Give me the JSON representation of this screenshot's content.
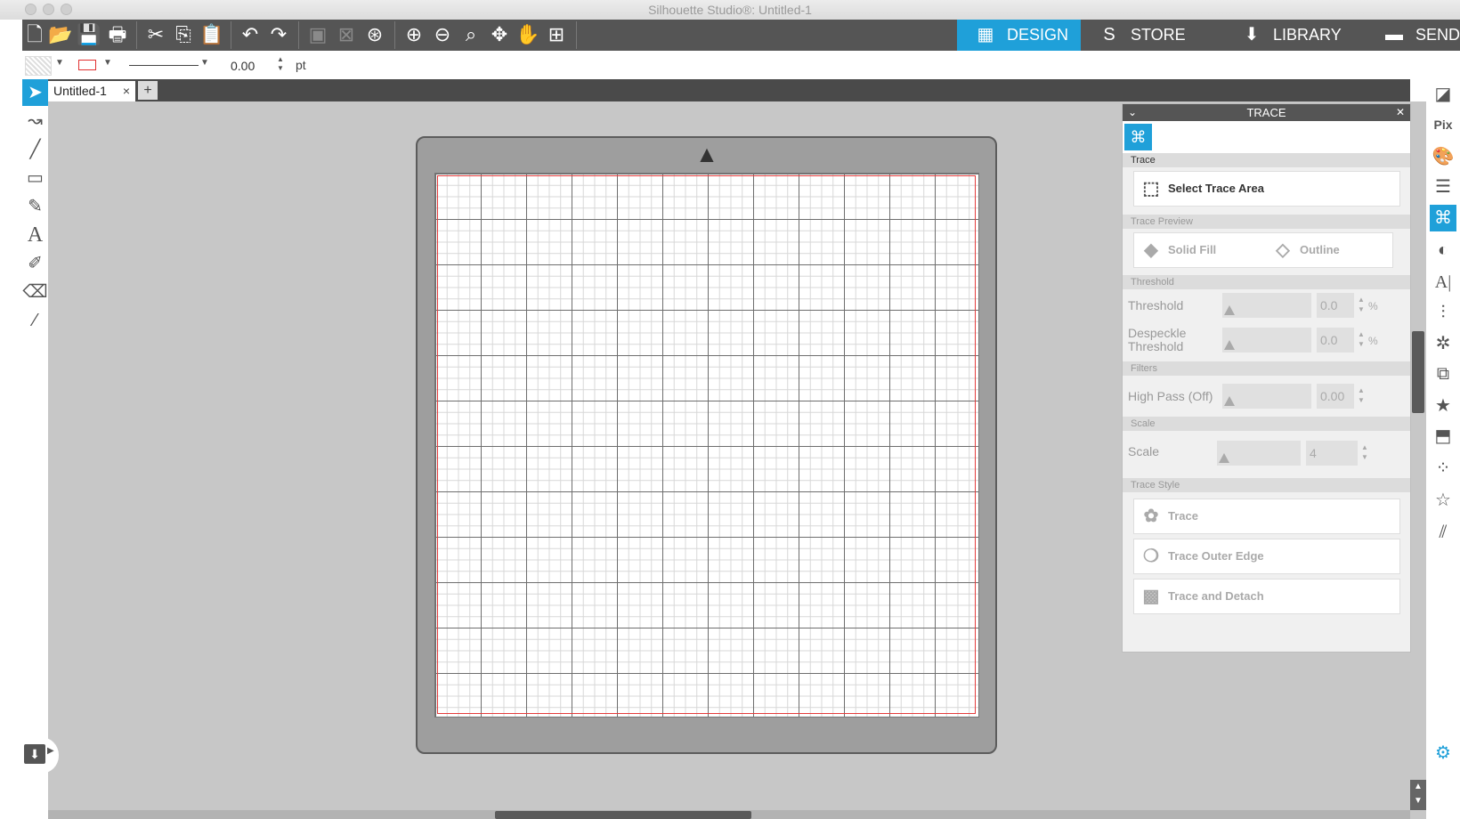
{
  "window": {
    "title": "Silhouette Studio®: Untitled-1"
  },
  "toolbar": {
    "icons": [
      "new-icon",
      "open-icon",
      "save-icon",
      "print-icon",
      "cut-icon",
      "copy-icon",
      "paste-icon",
      "undo-icon",
      "redo-icon",
      "group-icon",
      "ungroup-icon",
      "compound-icon",
      "zoom-in-icon",
      "zoom-out-icon",
      "zoom-select-icon",
      "pan-icon",
      "hand-icon",
      "fit-page-icon"
    ]
  },
  "nav": {
    "design": "DESIGN",
    "store": "STORE",
    "library": "LIBRARY",
    "send": "SEND"
  },
  "line_options": {
    "line_width": "0.00",
    "unit": "pt"
  },
  "document": {
    "tab_label": "Untitled-1",
    "close": "×",
    "add": "+"
  },
  "trace_panel": {
    "header": "TRACE",
    "collapse": "⌄",
    "close": "✕",
    "sections": {
      "trace": "Trace",
      "preview": "Trace Preview",
      "threshold": "Threshold",
      "filters": "Filters",
      "scale": "Scale",
      "style": "Trace Style"
    },
    "select_area": "Select Trace Area",
    "solid_fill": "Solid Fill",
    "outline": "Outline",
    "threshold_label": "Threshold",
    "threshold_value": "0.0",
    "threshold_unit": "%",
    "despeckle_label_1": "Despeckle",
    "despeckle_label_2": "Threshold",
    "despeckle_value": "0.0",
    "despeckle_unit": "%",
    "highpass_label": "High Pass (Off)",
    "highpass_value": "0.00",
    "scale_label": "Scale",
    "scale_value": "4",
    "trace_btn": "Trace",
    "trace_outer_btn": "Trace Outer Edge",
    "trace_detach_btn": "Trace and Detach"
  },
  "colors": {
    "accent": "#1fa0d9",
    "toolbar": "#555555",
    "cut_border": "#e43c3c"
  }
}
